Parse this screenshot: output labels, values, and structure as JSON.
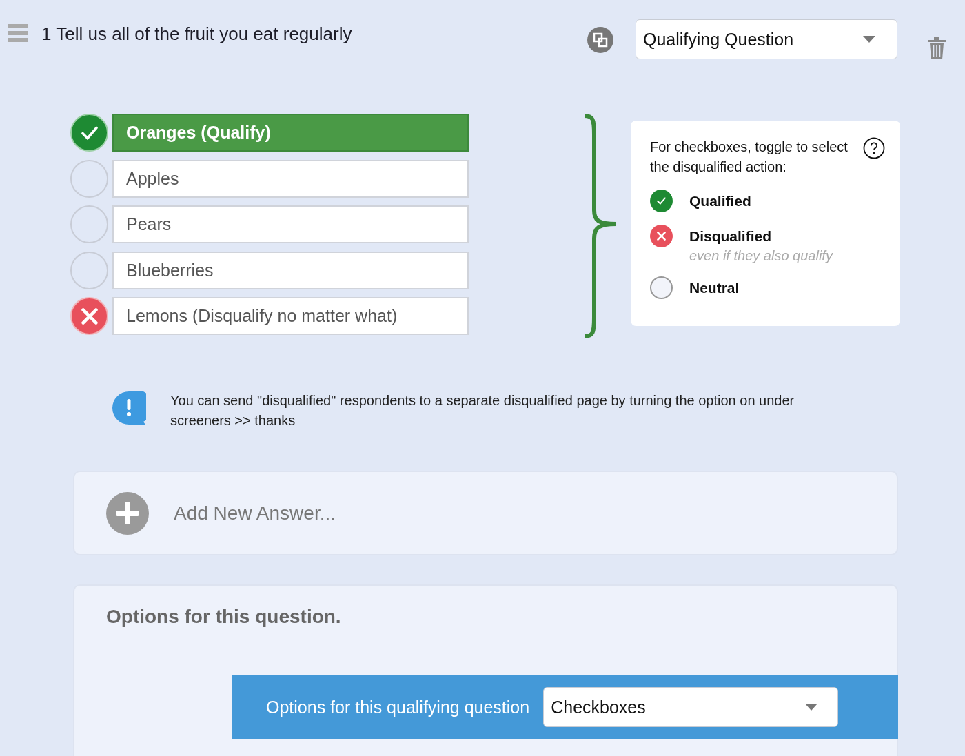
{
  "question": {
    "title": "1 Tell us all of the fruit you eat regularly",
    "type_select": {
      "value": "Qualifying Question"
    }
  },
  "answers": [
    {
      "label": "Oranges (Qualify)",
      "qualified": true,
      "disqualified": false
    },
    {
      "label": "Apples",
      "qualified": false,
      "disqualified": false
    },
    {
      "label": "Pears",
      "qualified": false,
      "disqualified": false
    },
    {
      "label": "Blueberries",
      "qualified": false,
      "disqualified": false
    },
    {
      "label": "Lemons (Disqualify no matter what)",
      "qualified": false,
      "disqualified": true
    }
  ],
  "legend": {
    "title": "For checkboxes, toggle to select the disqualified action:",
    "items": [
      {
        "kind": "qualified",
        "label": "Qualified"
      },
      {
        "kind": "disqualified",
        "label": "Disqualified",
        "note": "even if they also qualify"
      },
      {
        "kind": "neutral",
        "label": "Neutral"
      }
    ]
  },
  "info": {
    "text": "You can send \"disqualified\" respondents to a separate disqualified page by turning the option on under screeners >> thanks"
  },
  "add_answer": {
    "placeholder": "Add New Answer..."
  },
  "options": {
    "title": "Options for this question.",
    "qualifying": {
      "label": "Options for this qualifying question",
      "select_value": "Checkboxes"
    }
  }
}
